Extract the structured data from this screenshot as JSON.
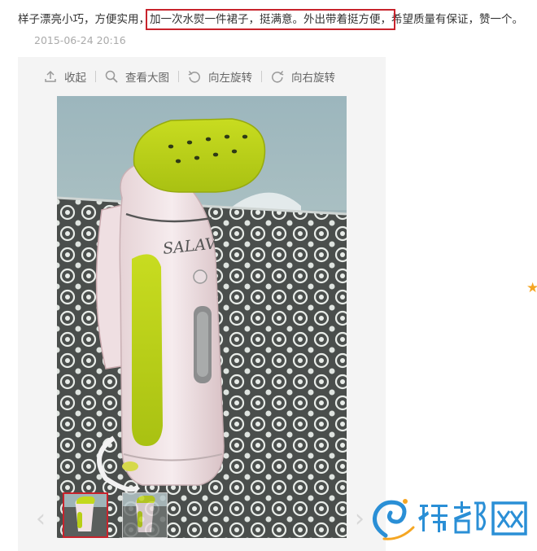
{
  "review": {
    "text_before": "样子漂亮小巧，方便实用，",
    "text_highlight": "加一次水熨一件裙子，挺满意。外出带着挺方便，",
    "text_after": "希望质量有保证，赞一个。",
    "date": "2015-06-24 20:16"
  },
  "toolbar": {
    "collapse": "收起",
    "view_large": "查看大图",
    "rotate_left": "向左旋转",
    "rotate_right": "向右旋转"
  },
  "gallery": {
    "prev_arrow": "‹",
    "next_arrow": "›",
    "thumbnail_count": 2,
    "selected_index": 0
  },
  "product": {
    "brand_text": "SALAV"
  },
  "watermark": {
    "text": "豫都网",
    "colors": [
      "#2a8fd6",
      "#f5a623"
    ]
  },
  "decoration": {
    "star": "★"
  }
}
